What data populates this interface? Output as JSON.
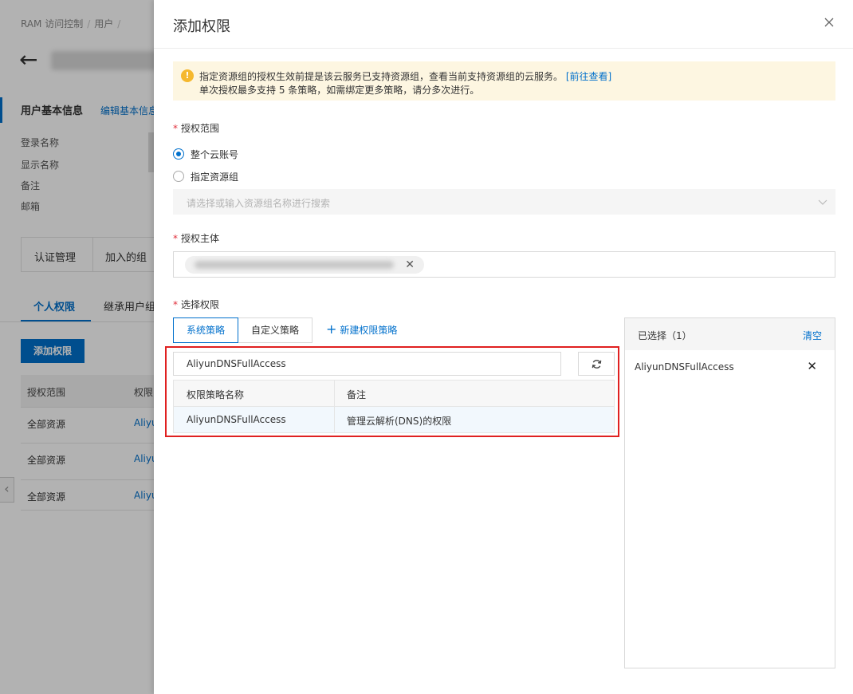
{
  "background": {
    "breadcrumb": [
      "RAM 访问控制",
      "用户"
    ],
    "section_title": "用户基本信息",
    "section_edit": "编辑基本信息",
    "info_labels": [
      "登录名称",
      "显示名称",
      "备注",
      "邮箱"
    ],
    "tabs": [
      "认证管理",
      "加入的组"
    ],
    "sub_tabs": [
      "个人权限",
      "继承用户组"
    ],
    "add_permission_button": "添加权限",
    "table_headers": [
      "授权范围",
      "权限"
    ],
    "table_rows": [
      {
        "scope": "全部资源",
        "policy": "Aliyu"
      },
      {
        "scope": "全部资源",
        "policy": "Aliyu"
      },
      {
        "scope": "全部资源",
        "policy": "Aliyu"
      }
    ]
  },
  "drawer": {
    "title": "添加权限",
    "notice": {
      "line1": "指定资源组的授权生效前提是该云服务已支持资源组，查看当前支持资源组的云服务。",
      "link": "[前往查看]",
      "line2": "单次授权最多支持 5 条策略，如需绑定更多策略，请分多次进行。"
    },
    "scope": {
      "label": "授权范围",
      "options": [
        "整个云账号",
        "指定资源组"
      ],
      "selected_index": 0,
      "resource_group_placeholder": "请选择或输入资源组名称进行搜索"
    },
    "principal": {
      "label": "授权主体",
      "tag_close": "✕"
    },
    "permissions": {
      "label": "选择权限",
      "tabs": [
        "系统策略",
        "自定义策略"
      ],
      "active_tab": 0,
      "new_policy": "新建权限策略",
      "search_value": "AliyunDNSFullAccess",
      "columns": [
        "权限策略名称",
        "备注"
      ],
      "rows": [
        {
          "name": "AliyunDNSFullAccess",
          "note": "管理云解析(DNS)的权限"
        }
      ]
    },
    "selected": {
      "title": "已选择（1）",
      "clear": "清空",
      "items": [
        "AliyunDNSFullAccess"
      ]
    }
  },
  "colors": {
    "accent": "#0070cc",
    "highlight": "#e02020",
    "notice_bg": "#fdf6e1",
    "warning": "#f5b82e"
  }
}
